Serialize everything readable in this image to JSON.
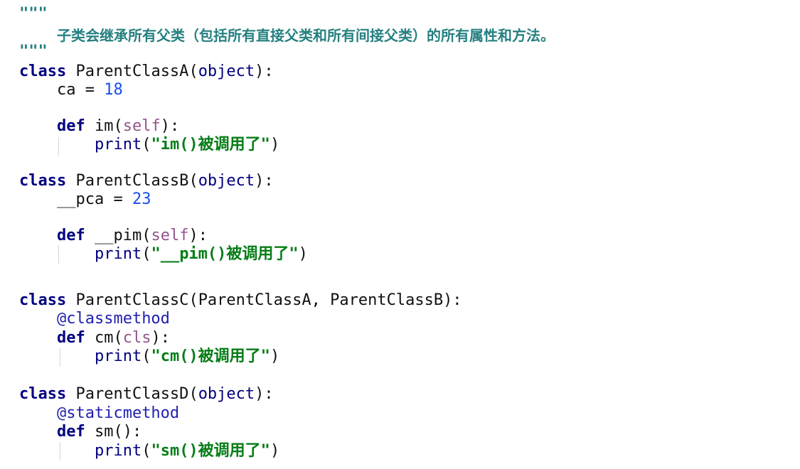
{
  "code": {
    "docstring_open": "\"\"\"",
    "docstring_text": "子类会继承所有父类（包括所有直接父类和所有间接父类）的所有属性和方法。",
    "docstring_close": "\"\"\"",
    "kw_class": "class",
    "kw_def": "def",
    "a": {
      "name": "ParentClassA",
      "base": "object",
      "attr_name": "ca",
      "attr_value": "18",
      "method": "im",
      "param": "self",
      "print_fn": "print",
      "message": "\"im()被调用了\""
    },
    "b": {
      "name": "ParentClassB",
      "base": "object",
      "attr_name": "__pca",
      "attr_value": "23",
      "method": "__pim",
      "param": "self",
      "print_fn": "print",
      "message": "\"__pim()被调用了\""
    },
    "c": {
      "name": "ParentClassC",
      "bases": "ParentClassA, ParentClassB",
      "decorator": "@classmethod",
      "method": "cm",
      "param": "cls",
      "print_fn": "print",
      "message": "\"cm()被调用了\""
    },
    "d": {
      "name": "ParentClassD",
      "base": "object",
      "decorator": "@staticmethod",
      "method": "sm",
      "print_fn": "print",
      "message": "\"sm()被调用了\""
    }
  }
}
